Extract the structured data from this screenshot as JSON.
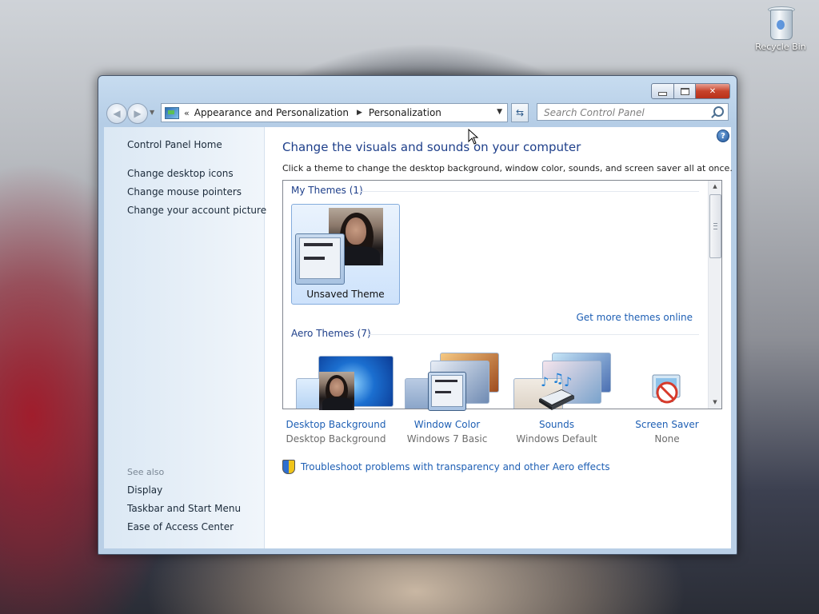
{
  "desktop": {
    "recycle_bin_label": "Recycle Bin"
  },
  "address_bar": {
    "overflow_chevron": "«",
    "crumbs": [
      "Appearance and Personalization",
      "Personalization"
    ]
  },
  "search": {
    "placeholder": "Search Control Panel"
  },
  "sidebar": {
    "home": "Control Panel Home",
    "links": [
      "Change desktop icons",
      "Change mouse pointers",
      "Change your account picture"
    ],
    "see_also_heading": "See also",
    "see_also": [
      "Display",
      "Taskbar and Start Menu",
      "Ease of Access Center"
    ]
  },
  "main": {
    "heading": "Change the visuals and sounds on your computer",
    "subheading": "Click a theme to change the desktop background, window color, sounds, and screen saver all at once.",
    "help_glyph": "?"
  },
  "themes": {
    "my_themes_title": "My Themes (1)",
    "selected_theme": "Unsaved Theme",
    "get_more_link": "Get more themes online",
    "aero_title": "Aero Themes (7)"
  },
  "settings": [
    {
      "link": "Desktop Background",
      "value": "Desktop Background",
      "icon": "desktop-background-icon"
    },
    {
      "link": "Window Color",
      "value": "Windows 7 Basic",
      "icon": "window-color-icon"
    },
    {
      "link": "Sounds",
      "value": "Windows Default",
      "icon": "sounds-icon"
    },
    {
      "link": "Screen Saver",
      "value": "None",
      "icon": "screen-saver-icon"
    }
  ],
  "troubleshoot_link": "Troubleshoot problems with transparency and other Aero effects",
  "colors": {
    "link": "#1e5fb4",
    "heading": "#1e3f8a",
    "close_button": "#c7432b"
  }
}
